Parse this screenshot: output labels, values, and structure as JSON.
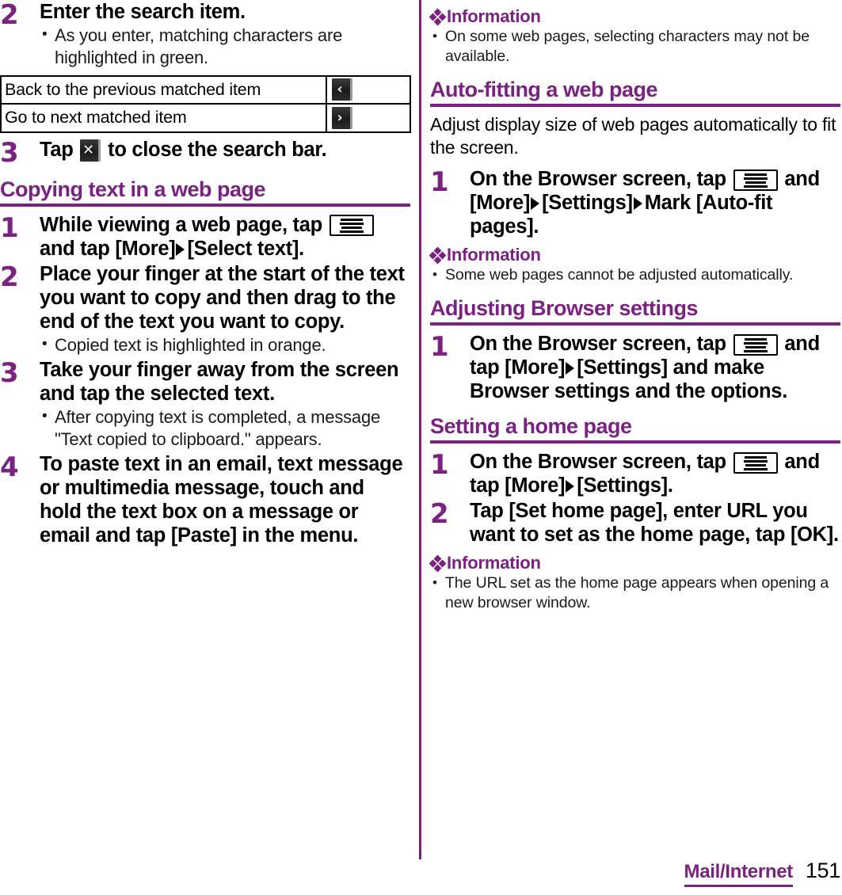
{
  "document": {
    "type": "user-manual-page",
    "accent_color": "#7a2182",
    "text_color": "#000000"
  },
  "left_column": {
    "step_enter_search": {
      "number": "2",
      "title": "Enter the search item.",
      "bullets": [
        "As you enter, matching characters are highlighted in green."
      ]
    },
    "key_table": {
      "rows": [
        {
          "label": "Back to the previous matched item",
          "icon": "chevron-left-key",
          "glyph": "‹"
        },
        {
          "label": "Go to next matched item",
          "icon": "chevron-right-key",
          "glyph": "›"
        }
      ]
    },
    "step_close_search_bar": {
      "number": "3",
      "text_before_icon": "Tap",
      "icon": "close-x-key",
      "icon_glyph": "✕",
      "text_after_icon": "to close the search bar."
    },
    "section_copying_text": {
      "heading": "Copying text in a web page",
      "steps": [
        {
          "number": "1",
          "part1": "While viewing a web page, tap",
          "icon": "menu-key",
          "part2": "and tap [More]",
          "arrow": "▶",
          "part3": "[Select text].",
          "bullets": []
        },
        {
          "number": "2",
          "title": "Place your finger at the start of the text you want to copy and then drag to the end of the text you want to copy.",
          "bullets": [
            "Copied text is highlighted in orange."
          ]
        },
        {
          "number": "3",
          "title": "Take your finger away from the screen and tap the selected text.",
          "bullets": [
            "After copying text is completed, a message \"Text copied to clipboard.\" appears."
          ]
        },
        {
          "number": "4",
          "title": "To paste text in an email, text message or multimedia message, touch and hold the text box on a message or email and tap [Paste] in the menu.",
          "bullets": []
        }
      ]
    }
  },
  "right_column": {
    "info_selecting_characters": {
      "heading": "Information",
      "bullets": [
        "On some web pages, selecting characters may not be available."
      ]
    },
    "section_auto_fitting": {
      "heading": "Auto-fitting a web page",
      "paragraph": "Adjust display size of web pages automatically to fit the screen.",
      "step": {
        "number": "1",
        "part1": "On the Browser screen, tap",
        "icon": "menu-key",
        "part2": "and [More]",
        "arrow1": "▶",
        "part3": "[Settings]",
        "arrow2": "▶",
        "part4": "Mark [Auto-fit pages]."
      },
      "info": {
        "heading": "Information",
        "bullets": [
          "Some web pages cannot be adjusted automatically."
        ]
      }
    },
    "section_adjusting_browser_settings": {
      "heading": "Adjusting Browser settings",
      "step": {
        "number": "1",
        "part1": "On the Browser screen, tap",
        "icon": "menu-key",
        "part2": "and tap [More]",
        "arrow1": "▶",
        "part3": "[Settings] and make Browser settings and the options."
      }
    },
    "section_setting_home_page": {
      "heading": "Setting a home page",
      "steps": [
        {
          "number": "1",
          "part1": "On the Browser screen, tap",
          "icon": "menu-key",
          "part2": "and tap [More]",
          "arrow1": "▶",
          "part3": "[Settings]."
        },
        {
          "number": "2",
          "title": "Tap [Set home page], enter URL you want to set as the home page, tap [OK]."
        }
      ],
      "info": {
        "heading": "Information",
        "bullets": [
          "The URL set as the home page appears when opening a new browser window."
        ]
      }
    }
  },
  "footer": {
    "chapter": "Mail/Internet",
    "page_number": "151"
  }
}
